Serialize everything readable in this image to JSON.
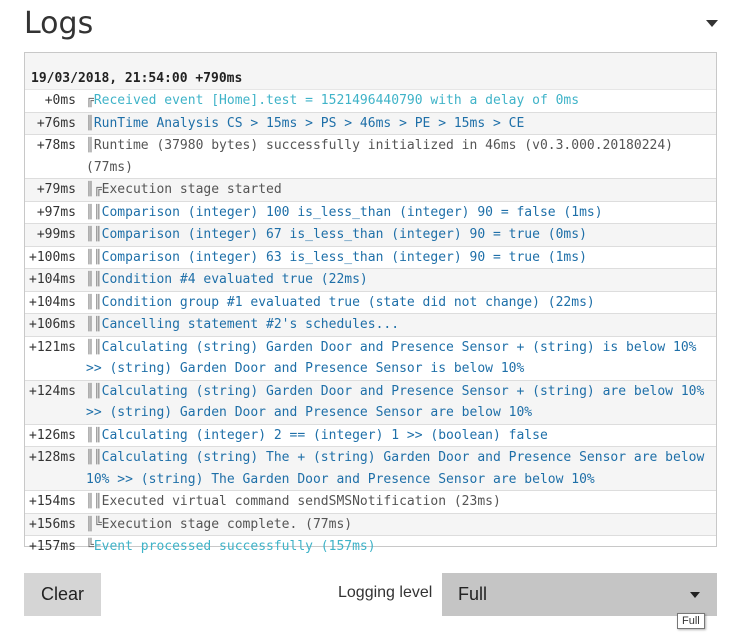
{
  "page": {
    "title": "Logs"
  },
  "log": {
    "header": "19/03/2018, 21:54:00 +790ms",
    "entries": [
      {
        "time": "+0ms",
        "indent": "╔",
        "msg": "Received event [Home].test = 1521496440790 with a delay of 0ms",
        "color": "cyan"
      },
      {
        "time": "+76ms",
        "indent": "║",
        "msg": "RunTime Analysis CS > 15ms > PS > 46ms > PE > 15ms > CE",
        "color": "blue"
      },
      {
        "time": "+78ms",
        "indent": "║",
        "msg": "Runtime (37980 bytes) successfully initialized in 46ms (v0.3.000.20180224) (77ms)",
        "color": "gray"
      },
      {
        "time": "+79ms",
        "indent": "║╔",
        "msg": "Execution stage started",
        "color": "gray"
      },
      {
        "time": "+97ms",
        "indent": "║║",
        "msg": "Comparison (integer) 100 is_less_than (integer) 90 = false (1ms)",
        "color": "blue"
      },
      {
        "time": "+99ms",
        "indent": "║║",
        "msg": "Comparison (integer) 67 is_less_than (integer) 90 = true (0ms)",
        "color": "blue"
      },
      {
        "time": "+100ms",
        "indent": "║║",
        "msg": "Comparison (integer) 63 is_less_than (integer) 90 = true (1ms)",
        "color": "blue"
      },
      {
        "time": "+104ms",
        "indent": "║║",
        "msg": "Condition #4 evaluated true (22ms)",
        "color": "blue"
      },
      {
        "time": "+104ms",
        "indent": "║║",
        "msg": "Condition group #1 evaluated true (state did not change) (22ms)",
        "color": "blue"
      },
      {
        "time": "+106ms",
        "indent": "║║",
        "msg": "Cancelling statement #2's schedules...",
        "color": "blue"
      },
      {
        "time": "+121ms",
        "indent": "║║",
        "msg": "Calculating (string) Garden Door and Presence Sensor + (string) is below 10% >> (string) Garden Door and Presence Sensor is below 10%",
        "color": "blue"
      },
      {
        "time": "+124ms",
        "indent": "║║",
        "msg": "Calculating (string) Garden Door and Presence Sensor + (string) are below 10% >> (string) Garden Door and Presence Sensor are below 10%",
        "color": "blue"
      },
      {
        "time": "+126ms",
        "indent": "║║",
        "msg": "Calculating (integer) 2 == (integer) 1 >> (boolean) false",
        "color": "blue"
      },
      {
        "time": "+128ms",
        "indent": "║║",
        "msg": "Calculating (string) The + (string) Garden Door and Presence Sensor are below 10% >> (string) The Garden Door and Presence Sensor are below 10%",
        "color": "blue"
      },
      {
        "time": "+154ms",
        "indent": "║║",
        "msg": "Executed virtual command sendSMSNotification (23ms)",
        "color": "gray"
      },
      {
        "time": "+156ms",
        "indent": "║╚",
        "msg": "Execution stage complete. (77ms)",
        "color": "gray"
      },
      {
        "time": "+157ms",
        "indent": "╚",
        "msg": "Event processed successfully (157ms)",
        "color": "cyan"
      }
    ]
  },
  "controls": {
    "clear_label": "Clear",
    "logging_level_label": "Logging level",
    "logging_level_value": "Full",
    "tooltip": "Full"
  },
  "colors": {
    "blue": "#1e6fa8",
    "cyan": "#3fb3c8",
    "gray": "#555555"
  },
  "icons": {
    "collapse": "chevron-down-icon",
    "select": "dropdown-caret-icon"
  }
}
